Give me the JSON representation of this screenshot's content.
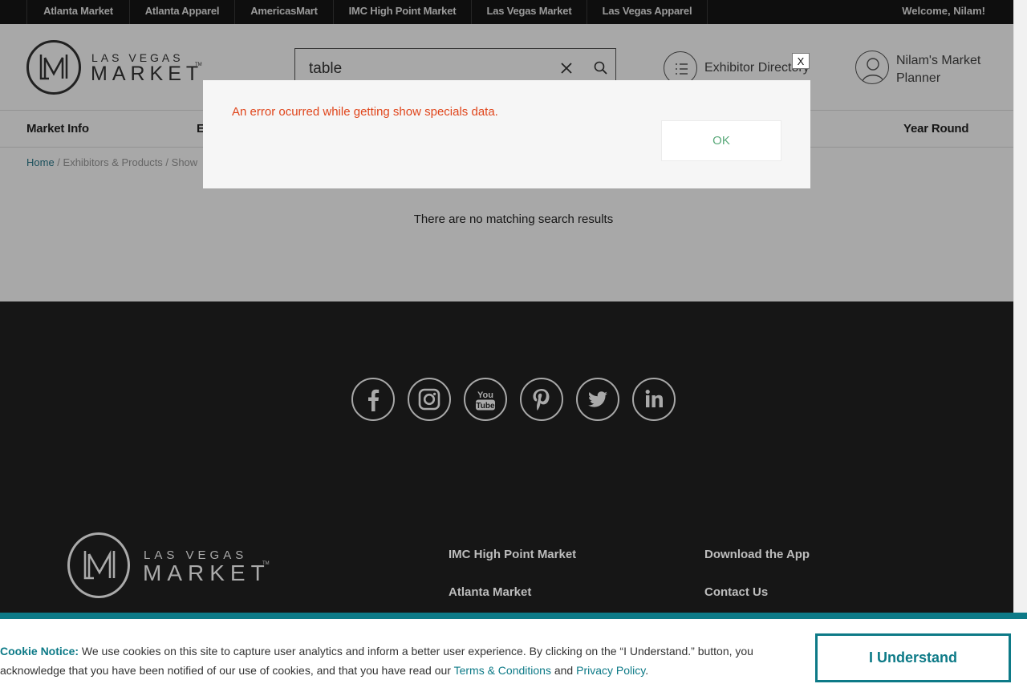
{
  "topbar": {
    "tabs": [
      "Atlanta Market",
      "Atlanta Apparel",
      "AmericasMart",
      "IMC High Point Market",
      "Las Vegas Market",
      "Las Vegas Apparel"
    ],
    "welcome": "Welcome, Nilam!"
  },
  "header": {
    "logo": {
      "line1": "LAS VEGAS",
      "line2": "MARKET",
      "tm": "TM"
    },
    "search": {
      "value": "table",
      "placeholder": ""
    },
    "exhibitor_directory": "Exhibitor Directory",
    "planner": "Nilam's Market Planner"
  },
  "nav": {
    "items": [
      "Market Info",
      "E",
      "Year Round"
    ]
  },
  "breadcrumb": {
    "home": "Home",
    "sep1": " / ",
    "exhibitors": "Exhibitors & Products",
    "sep2": " / ",
    "current": "Show"
  },
  "results": {
    "empty_text": "There are no matching search results"
  },
  "modal": {
    "message": "An error ocurred while getting show specials data.",
    "ok_label": "OK",
    "close_label": "X"
  },
  "footer": {
    "social": [
      "facebook-icon",
      "instagram-icon",
      "youtube-icon",
      "pinterest-icon",
      "twitter-icon",
      "linkedin-icon"
    ],
    "youtube_text_1": "You",
    "youtube_text_2": "Tube",
    "logo": {
      "line1": "LAS VEGAS",
      "line2": "MARKET",
      "tm": "TM"
    },
    "links_col1": [
      "IMC High Point Market",
      "Atlanta Market"
    ],
    "links_col2": [
      "Download the App",
      "Contact Us"
    ]
  },
  "cookie": {
    "heading": "Cookie Notice:",
    "text": " We use cookies on this site to capture user analytics and inform a better user experience. By clicking on the “I Understand.” button, you acknowledge that you have been notified of our use of cookies, and that you have read our ",
    "terms": "Terms & Conditions",
    "and": " and ",
    "privacy": "Privacy Policy",
    "end": ".",
    "button": "I Understand"
  },
  "colors": {
    "accent": "#0d7a87",
    "error": "#e0451b",
    "ok_text": "#5aa97a",
    "topbar_bg": "#161616",
    "footer_bg": "#161616"
  }
}
